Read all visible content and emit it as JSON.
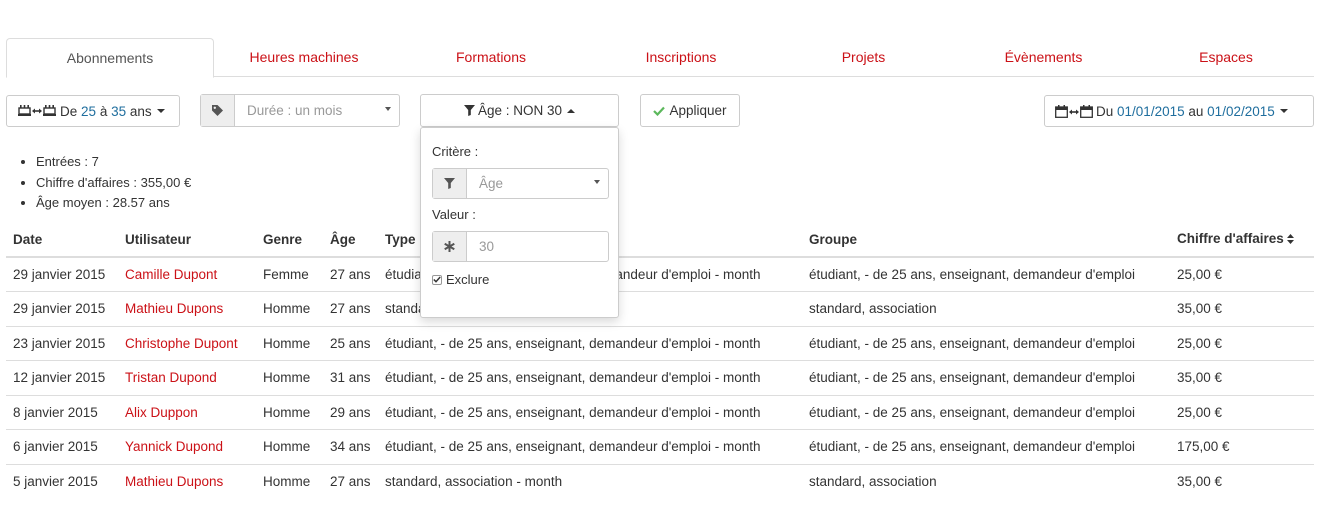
{
  "tabs": [
    {
      "label": "Abonnements",
      "active": true
    },
    {
      "label": "Heures machines",
      "active": false
    },
    {
      "label": "Formations",
      "active": false
    },
    {
      "label": "Inscriptions",
      "active": false
    },
    {
      "label": "Projets",
      "active": false
    },
    {
      "label": "Évènements",
      "active": false
    },
    {
      "label": "Espaces",
      "active": false
    }
  ],
  "toolbar": {
    "age_range": {
      "prefix": "De",
      "from": "25",
      "sep": "à",
      "to": "35",
      "suffix": "ans"
    },
    "duration_placeholder": "Durée : un mois",
    "age_filter_label": "Âge : NON 30",
    "apply_label": "Appliquer",
    "date_range": {
      "prefix": "Du",
      "from": "01/01/2015",
      "sep": "au",
      "to": "01/02/2015"
    }
  },
  "popover": {
    "criterion_label": "Critère :",
    "criterion_placeholder": "Âge",
    "value_label": "Valeur :",
    "value": "30",
    "exclude_label": "Exclure",
    "exclude_checked": true
  },
  "stats": [
    "Entrées : 7",
    "Chiffre d'affaires : 355,00 €",
    "Âge moyen : 28.57 ans"
  ],
  "table": {
    "headers": {
      "date": "Date",
      "user": "Utilisateur",
      "gender": "Genre",
      "age": "Âge",
      "type": "Type",
      "group": "Groupe",
      "revenue": "Chiffre d'affaires"
    },
    "rows": [
      {
        "date": "29 janvier 2015",
        "user": "Camille Dupont",
        "gender": "Femme",
        "age": "27 ans",
        "type": "étudiant, - de 25 ans, enseignant, demandeur d'emploi - month",
        "group": "étudiant, - de 25 ans, enseignant, demandeur d'emploi",
        "revenue": "25,00 €"
      },
      {
        "date": "29 janvier 2015",
        "user": "Mathieu Dupons",
        "gender": "Homme",
        "age": "27 ans",
        "type": "standard, association - month",
        "group": "standard, association",
        "revenue": "35,00 €"
      },
      {
        "date": "23 janvier 2015",
        "user": "Christophe Dupont",
        "gender": "Homme",
        "age": "25 ans",
        "type": "étudiant, - de 25 ans, enseignant, demandeur d'emploi - month",
        "group": "étudiant, - de 25 ans, enseignant, demandeur d'emploi",
        "revenue": "25,00 €"
      },
      {
        "date": "12 janvier 2015",
        "user": "Tristan Dupond",
        "gender": "Homme",
        "age": "31 ans",
        "type": "étudiant, - de 25 ans, enseignant, demandeur d'emploi - month",
        "group": "étudiant, - de 25 ans, enseignant, demandeur d'emploi",
        "revenue": "35,00 €"
      },
      {
        "date": "8 janvier 2015",
        "user": "Alix Duppon",
        "gender": "Homme",
        "age": "29 ans",
        "type": "étudiant, - de 25 ans, enseignant, demandeur d'emploi - month",
        "group": "étudiant, - de 25 ans, enseignant, demandeur d'emploi",
        "revenue": "25,00 €"
      },
      {
        "date": "6 janvier 2015",
        "user": "Yannick Dupond",
        "gender": "Homme",
        "age": "34 ans",
        "type": "étudiant, - de 25 ans, enseignant, demandeur d'emploi - month",
        "group": "étudiant, - de 25 ans, enseignant, demandeur d'emploi",
        "revenue": "175,00 €"
      },
      {
        "date": "5 janvier 2015",
        "user": "Mathieu Dupons",
        "gender": "Homme",
        "age": "27 ans",
        "type": "standard, association - month",
        "group": "standard, association",
        "revenue": "35,00 €"
      }
    ]
  },
  "colors": {
    "link": "#cb1117",
    "accent_blue": "#1f6e9e",
    "apply_check": "#5cb85c"
  }
}
